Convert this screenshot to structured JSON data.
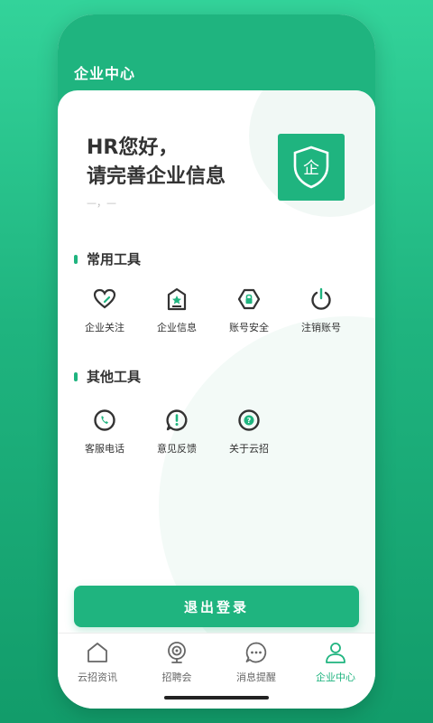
{
  "header": {
    "title": "企业中心"
  },
  "greeting": {
    "line1": "HR您好，",
    "line2": "请完善企业信息",
    "sub": "—，—"
  },
  "logo": {
    "char": "企"
  },
  "common_tools": {
    "title": "常用工具",
    "items": [
      {
        "label": "企业关注",
        "icon": "heart-icon"
      },
      {
        "label": "企业信息",
        "icon": "company-info-icon"
      },
      {
        "label": "账号安全",
        "icon": "lock-icon"
      },
      {
        "label": "注销账号",
        "icon": "power-icon"
      }
    ]
  },
  "other_tools": {
    "title": "其他工具",
    "items": [
      {
        "label": "客服电话",
        "icon": "phone-icon"
      },
      {
        "label": "意见反馈",
        "icon": "exclamation-icon"
      },
      {
        "label": "关于云招",
        "icon": "question-icon"
      }
    ]
  },
  "logout_label": "退出登录",
  "tabs": [
    {
      "label": "云招资讯",
      "icon": "home-icon",
      "active": false
    },
    {
      "label": "招聘会",
      "icon": "camera-icon",
      "active": false
    },
    {
      "label": "消息提醒",
      "icon": "chat-icon",
      "active": false
    },
    {
      "label": "企业中心",
      "icon": "user-icon",
      "active": true
    }
  ],
  "colors": {
    "accent": "#1fb47f",
    "text": "#333333"
  }
}
